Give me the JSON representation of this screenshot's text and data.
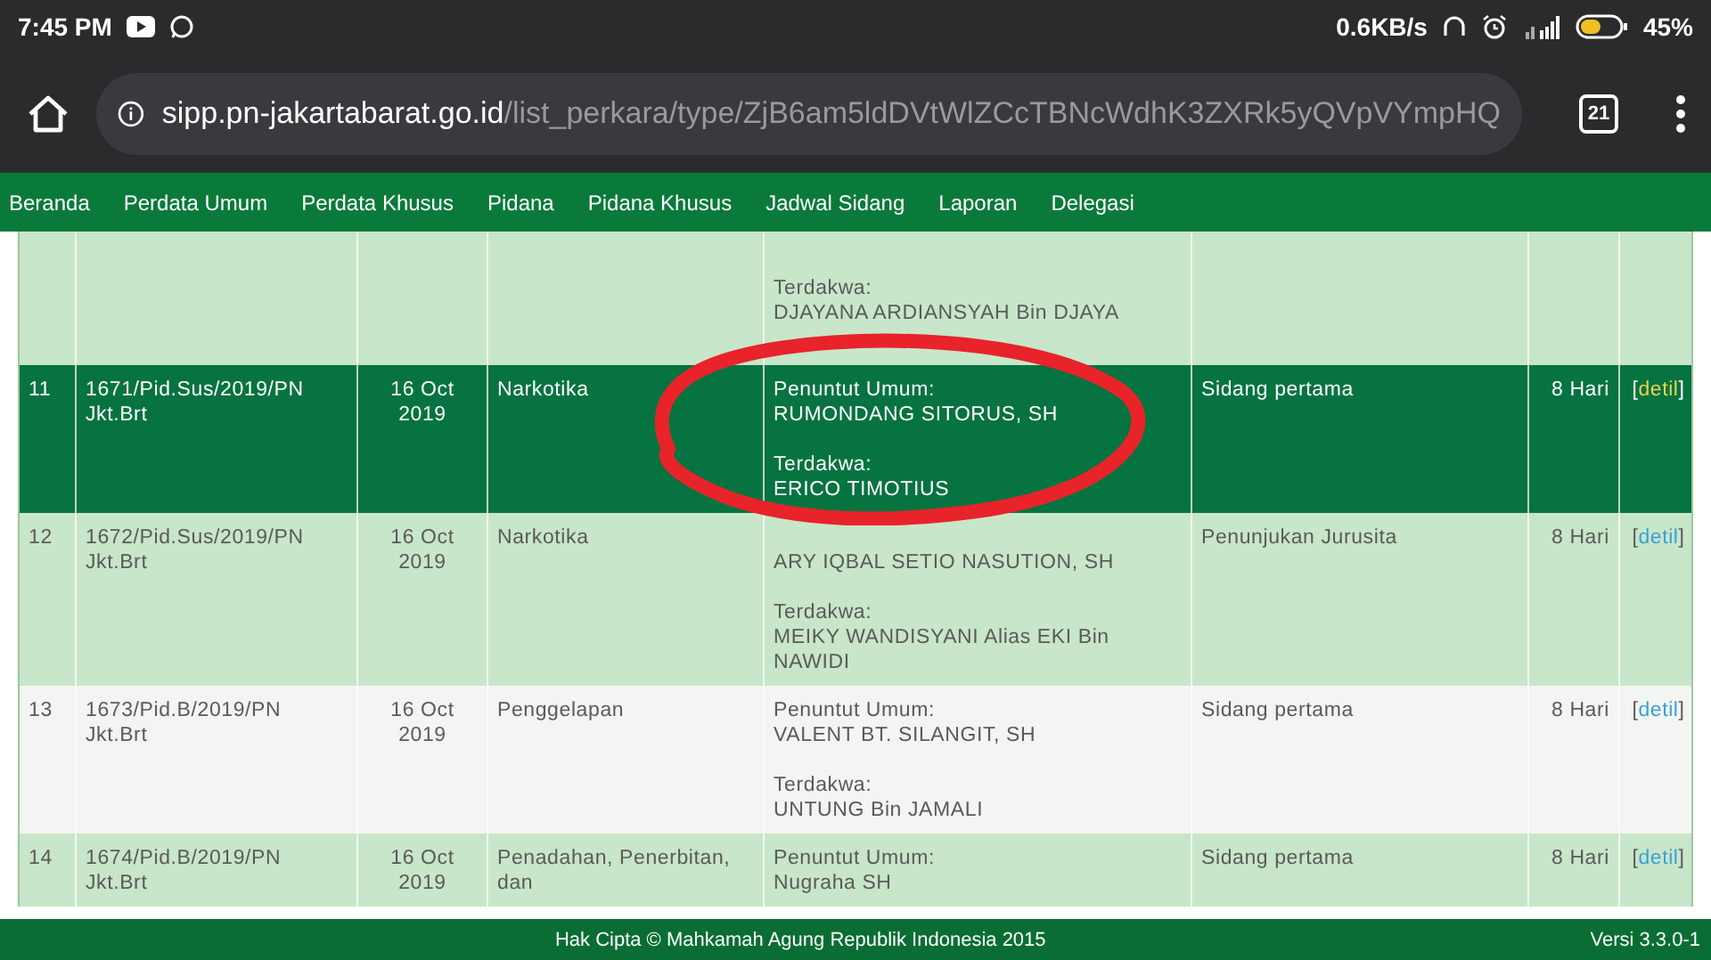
{
  "status_bar": {
    "time": "7:45 PM",
    "speed": "0.6KB/s",
    "battery": "45%"
  },
  "browser": {
    "url_host": "sipp.pn-jakartabarat.go.id",
    "url_path": "/list_perkara/type/ZjB6am5ldDVtWlZCcTBNcWdhK3ZXRk5yQVpVYmpHQ",
    "tab_count": "21"
  },
  "nav": [
    "Beranda",
    "Perdata Umum",
    "Perdata Khusus",
    "Pidana",
    "Pidana Khusus",
    "Jadwal Sidang",
    "Laporan",
    "Delegasi"
  ],
  "rows": [
    {
      "kind": "partial",
      "selected": false,
      "parties": [
        {
          "label": "Terdakwa:",
          "name": "DJAYANA ARDIANSYAH Bin DJAYA"
        }
      ]
    },
    {
      "kind": "full",
      "selected": true,
      "number": "11",
      "case_no": "1671/Pid.Sus/2019/PN Jkt.Brt",
      "date": "16 Oct 2019",
      "classification": "Narkotika",
      "parties": [
        {
          "label": "Penuntut Umum:",
          "name": "RUMONDANG SITORUS, SH"
        },
        {
          "label": "Terdakwa:",
          "name": "ERICO TIMOTIUS"
        }
      ],
      "stage": "Sidang pertama",
      "duration": "8 Hari",
      "link": {
        "open": "[",
        "label": "detil",
        "close": "]"
      }
    },
    {
      "kind": "full",
      "selected": false,
      "number": "12",
      "case_no": "1672/Pid.Sus/2019/PN Jkt.Brt",
      "date": "16 Oct 2019",
      "classification": "Narkotika",
      "parties": [
        {
          "name": "ARY IQBAL SETIO NASUTION, SH"
        },
        {
          "label": "Terdakwa:",
          "name": "MEIKY WANDISYANI Alias EKI Bin NAWIDI"
        }
      ],
      "stage": "Penunjukan Jurusita",
      "duration": "8 Hari",
      "link": {
        "open": "[",
        "label": "detil",
        "close": "]"
      }
    },
    {
      "kind": "full",
      "selected": false,
      "number": "13",
      "case_no": "1673/Pid.B/2019/PN Jkt.Brt",
      "date": "16 Oct 2019",
      "classification": "Penggelapan",
      "parties": [
        {
          "label": "Penuntut Umum:",
          "name": "VALENT BT. SILANGIT, SH"
        },
        {
          "label": "Terdakwa:",
          "name": "UNTUNG Bin JAMALI"
        }
      ],
      "stage": "Sidang pertama",
      "duration": "8 Hari",
      "link": {
        "open": "[",
        "label": "detil",
        "close": "]"
      }
    },
    {
      "kind": "full",
      "selected": false,
      "number": "14",
      "case_no": "1674/Pid.B/2019/PN Jkt.Brt",
      "date": "16 Oct 2019",
      "classification": "Penadahan, Penerbitan, dan",
      "parties": [
        {
          "label": "Penuntut Umum:",
          "name": "Nugraha SH"
        }
      ],
      "stage": "Sidang pertama",
      "duration": "8 Hari",
      "link": {
        "open": "[",
        "label": "detil",
        "close": "]"
      }
    }
  ],
  "footer": {
    "copyright": "Hak Cipta © Mahkamah Agung Republik Indonesia 2015",
    "version": "Versi 3.3.0-1"
  }
}
